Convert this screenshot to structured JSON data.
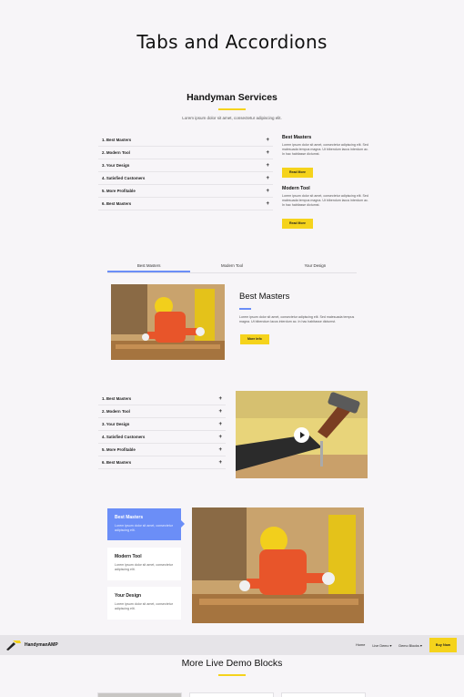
{
  "page": {
    "title": "Tabs and Accordions"
  },
  "services": {
    "title": "Handyman Services",
    "subtitle": "Lorem ipsum dolor sit amet, consectetur adipiscing elit.",
    "accordion": [
      "1. Best Masters",
      "2. Modern Tool",
      "3. Your Design",
      "4. Satisfied Customers",
      "5. More Profitable",
      "6. Best Masters"
    ],
    "plus": "+",
    "cards": [
      {
        "title": "Best Masters",
        "text": "Lorem ipsum dolor sit amet, consectetur adipiscing elit. Sed malesuada tempus magna. Ut bibendum lacus interdum ac. In hac habitasse dictumst.",
        "button": "Read More"
      },
      {
        "title": "Modern Tool",
        "text": "Lorem ipsum dolor sit amet, consectetur adipiscing elit. Sed malesuada tempus magna. Ut bibendum lacus interdum ac. In hac habitasse dictumst.",
        "button": "Read More"
      }
    ]
  },
  "tabs": {
    "labels": [
      "Best Masters",
      "Modern Tool",
      "Your Design"
    ],
    "active_title": "Best Masters",
    "active_text": "Lorem ipsum dolor sit amet, consectetur adipiscing elit. Sed malesuada tempus magna. Ut bibendum lacus interdum ac. In hac habitasse dictumst.",
    "button": "More Info"
  },
  "accordion2": [
    "1. Best Masters",
    "2. Modern Tool",
    "3. Your Design",
    "4. Satisfied Customers",
    "5. More Profitable",
    "6. Best Masters"
  ],
  "vertical_tabs": [
    {
      "title": "Best Masters",
      "text": "Lorem ipsum dolor sit amet, consectetur adipiscing elit."
    },
    {
      "title": "Modern Tool",
      "text": "Lorem ipsum dolor sit amet, consectetur adipiscing elit."
    },
    {
      "title": "Your Design",
      "text": "Lorem ipsum dolor sit amet, consectetur adipiscing elit."
    }
  ],
  "navbar": {
    "brand": "HandymanAMP",
    "links": [
      "Home",
      "Live Demo ▾",
      "Demo Blocks ▾"
    ],
    "buy": "Buy Now"
  },
  "more": {
    "title": "More Live Demo Blocks"
  },
  "colors": {
    "accent_yellow": "#f5d31c",
    "accent_blue": "#6b8ef7",
    "background": "#f7f5f8"
  }
}
